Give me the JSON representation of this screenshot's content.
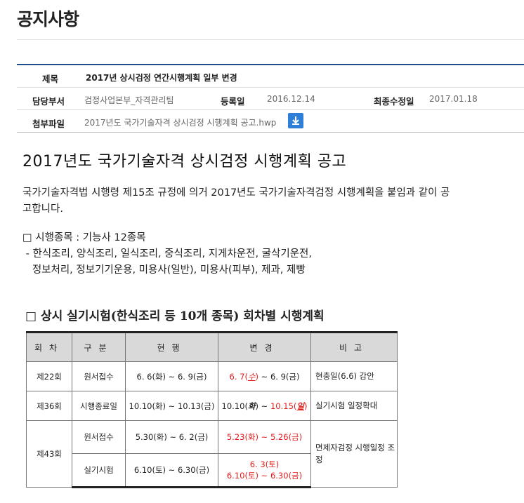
{
  "page": {
    "title": "공지사항"
  },
  "meta": {
    "subject_label": "제목",
    "subject_value": "2017년 상시검정 연간시행계획 일부 변경",
    "dept_label": "담당부서",
    "dept_value": "검정사업본부_자격관리팀",
    "reg_label": "등록일",
    "reg_value": "2016.12.14",
    "mod_label": "최종수정일",
    "mod_value": "2017.01.18",
    "attach_label": "첨부파일",
    "attach_value": "2017년도 국가기술자격 상시검정 시행계획 공고.hwp",
    "download_icon": "download-icon"
  },
  "content": {
    "title": "2017년도 국가기술자격 상시검정 시행계획 공고",
    "para_line1": "국가기술자격법 시행령 제15조 규정에 의거 2017년도 국가기술자격검정 시행계획을 붙임과 같이 공",
    "para_line2": "고합니다.",
    "list_line1": "□ 시행종목 : 기능사 12종목",
    "list_line2": " - 한식조리, 양식조리, 일식조리, 중식조리, 지게차운전, 굴삭기운전,",
    "list_line3": "   정보처리, 정보기기운용, 미용사(일반), 미용사(피부), 제과, 제빵",
    "section_title": "□ 상시 실기시험(한식조리 등 10개 종목) 회차별 시행계획"
  },
  "table": {
    "headers": [
      "회차",
      "구분",
      "현행",
      "변경",
      "비고"
    ],
    "r1": {
      "round": "제22회",
      "type": "원서접수",
      "current": "6. 6(화) ~ 6. 9(금)",
      "change_a": "6. 7(",
      "change_b": "수",
      "change_c": ")",
      "change_d": " ~ 6. 9(금)",
      "note": "현충일(6.6) 감안"
    },
    "r2": {
      "round": "제36회",
      "type": "시행종료일",
      "current": "10.10(화) ~ 10.13(금)",
      "change_a": "10.10(",
      "change_b": "화",
      "change_c": ") ~ ",
      "change_d": "10.15(",
      "change_e": "일",
      "change_f": ")",
      "note": "실기시험 일정확대"
    },
    "r3": {
      "round": "제43회",
      "type": "원서접수",
      "current": "5.30(화) ~ 6. 2(금)",
      "change": "5.23(화) ~ 5.26(금)",
      "note": "면제자검정 시행일정 조정"
    },
    "r4": {
      "type": "실기시험",
      "current": "6.10(토) ~ 6.30(금)",
      "change_line1": "6. 3(토)",
      "change_line2": "6.10(토) ~ 6.30(금)"
    }
  },
  "colors": {
    "accent": "#1f4e8c",
    "download": "#2f7fd8",
    "highlight": "#e21b1b"
  }
}
